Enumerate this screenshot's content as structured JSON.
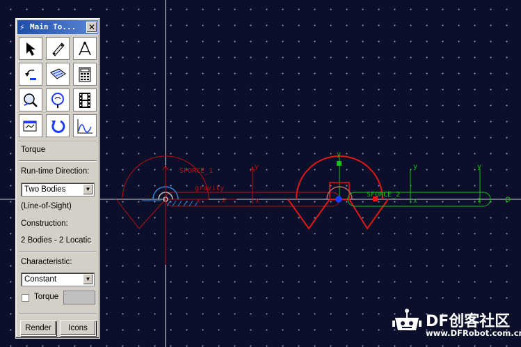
{
  "window": {
    "title": "Main To...",
    "close_glyph": "✕"
  },
  "toolbox": {
    "tools": [
      {
        "icon": "select-arrow-icon"
      },
      {
        "icon": "link-part-icon"
      },
      {
        "icon": "joint-pendulum-icon"
      },
      {
        "icon": "undo-move-icon"
      },
      {
        "icon": "mesh-plate-icon"
      },
      {
        "icon": "calculator-icon"
      },
      {
        "icon": "zoom-view-icon"
      },
      {
        "icon": "zoom-region-icon"
      },
      {
        "icon": "film-animation-icon"
      },
      {
        "icon": "plot-window-icon"
      },
      {
        "icon": "rotate-icon"
      },
      {
        "icon": "chart-postprocess-icon"
      }
    ],
    "active_tool": "Torque",
    "runtime_direction_label": "Run-time Direction:",
    "runtime_direction_value": "Two Bodies",
    "line_of_sight": "(Line-of-Sight)",
    "construction_label": "Construction:",
    "construction_value": "2 Bodies - 2 Locatic",
    "characteristic_label": "Characteristic:",
    "characteristic_value": "Constant",
    "torque_checkbox_label": "Torque",
    "render_button": "Render",
    "icons_button": "Icons"
  },
  "scene": {
    "labels": {
      "sforce1": "SFORCE_1",
      "sforce2": "SFORCE_2",
      "gravity": "gravity",
      "axis_x": "x",
      "axis_y": "y",
      "axis_z": "z"
    },
    "colors": {
      "background": "#0b0f2a",
      "red": "#e01818",
      "dark_red": "#b81010",
      "green": "#18c018",
      "grid": "#9aa0b8"
    }
  },
  "watermark": {
    "brand": "DF创客社区",
    "url": "www.DFRobot.com.cn"
  }
}
